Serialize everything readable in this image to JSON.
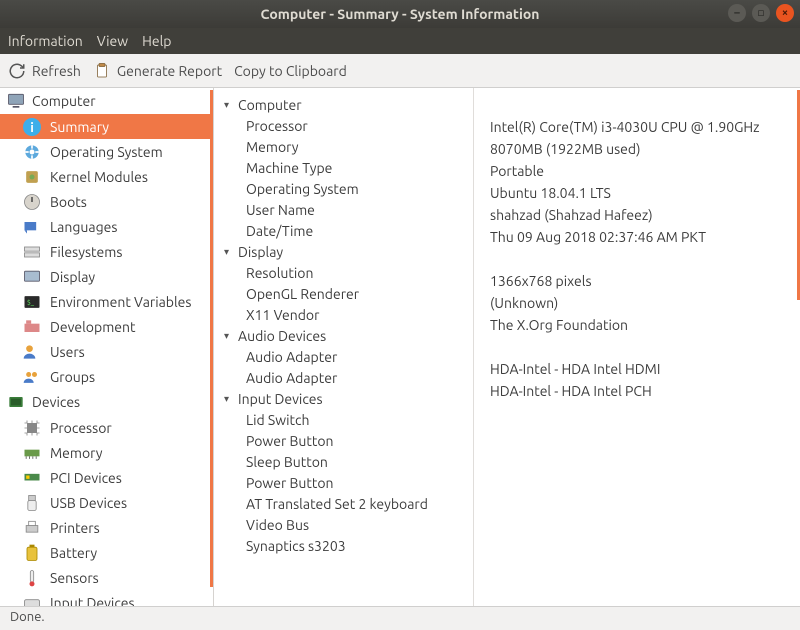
{
  "window": {
    "title": "Computer - Summary - System Information"
  },
  "menubar": {
    "information": "Information",
    "view": "View",
    "help": "Help"
  },
  "toolbar": {
    "refresh": "Refresh",
    "generate": "Generate Report",
    "copy": "Copy to Clipboard"
  },
  "sidebar": {
    "groups": [
      {
        "label": "Computer",
        "items": [
          {
            "label": "Summary",
            "selected": true
          },
          {
            "label": "Operating System"
          },
          {
            "label": "Kernel Modules"
          },
          {
            "label": "Boots"
          },
          {
            "label": "Languages"
          },
          {
            "label": "Filesystems"
          },
          {
            "label": "Display"
          },
          {
            "label": "Environment Variables"
          },
          {
            "label": "Development"
          },
          {
            "label": "Users"
          },
          {
            "label": "Groups"
          }
        ]
      },
      {
        "label": "Devices",
        "items": [
          {
            "label": "Processor"
          },
          {
            "label": "Memory"
          },
          {
            "label": "PCI Devices"
          },
          {
            "label": "USB Devices"
          },
          {
            "label": "Printers"
          },
          {
            "label": "Battery"
          },
          {
            "label": "Sensors"
          },
          {
            "label": "Input Devices"
          }
        ]
      }
    ]
  },
  "summary": {
    "groups": [
      {
        "title": "Computer",
        "rows": [
          {
            "k": "Processor",
            "v": "Intel(R) Core(TM) i3-4030U CPU @ 1.90GHz"
          },
          {
            "k": "Memory",
            "v": "8070MB (1922MB used)"
          },
          {
            "k": "Machine Type",
            "v": "Portable"
          },
          {
            "k": "Operating System",
            "v": "Ubuntu 18.04.1 LTS"
          },
          {
            "k": "User Name",
            "v": "shahzad (Shahzad Hafeez)"
          },
          {
            "k": "Date/Time",
            "v": "Thu 09 Aug 2018 02:37:46 AM PKT"
          }
        ]
      },
      {
        "title": "Display",
        "rows": [
          {
            "k": "Resolution",
            "v": "1366x768 pixels"
          },
          {
            "k": "OpenGL Renderer",
            "v": "(Unknown)"
          },
          {
            "k": "X11 Vendor",
            "v": "The X.Org Foundation"
          }
        ]
      },
      {
        "title": "Audio Devices",
        "rows": [
          {
            "k": "Audio Adapter",
            "v": "HDA-Intel - HDA Intel HDMI"
          },
          {
            "k": "Audio Adapter",
            "v": "HDA-Intel - HDA Intel PCH"
          }
        ]
      },
      {
        "title": "Input Devices",
        "rows": [
          {
            "k": "Lid Switch",
            "v": ""
          },
          {
            "k": "Power Button",
            "v": ""
          },
          {
            "k": "Sleep Button",
            "v": ""
          },
          {
            "k": "Power Button",
            "v": ""
          },
          {
            "k": "AT Translated Set 2 keyboard",
            "v": ""
          },
          {
            "k": "Video Bus",
            "v": ""
          },
          {
            "k": "Synaptics s3203",
            "v": ""
          }
        ]
      }
    ]
  },
  "statusbar": {
    "text": "Done."
  }
}
